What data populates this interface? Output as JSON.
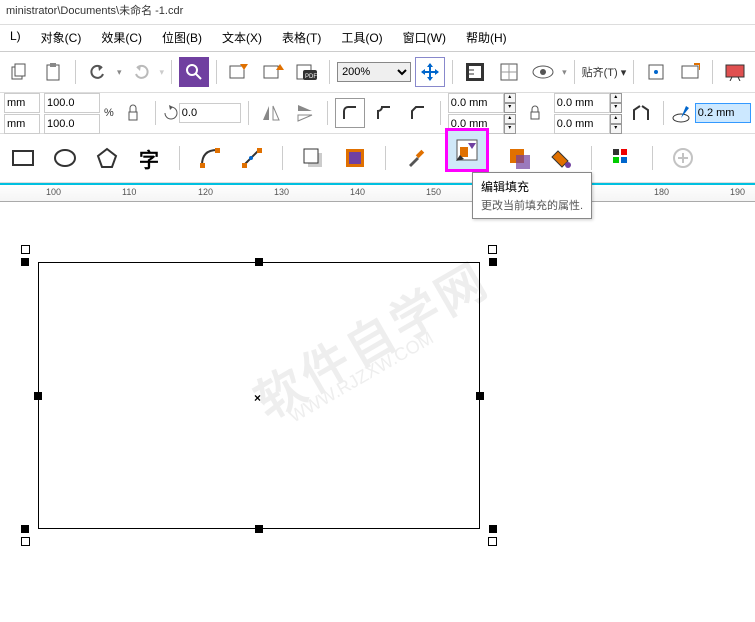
{
  "title": "ministrator\\Documents\\未命名 -1.cdr",
  "menu": {
    "layout": "L)",
    "object": "对象(C)",
    "effects": "效果(C)",
    "bitmap": "位图(B)",
    "text": "文本(X)",
    "table": "表格(T)",
    "tools": "工具(O)",
    "window": "窗口(W)",
    "help": "帮助(H)"
  },
  "toolbar": {
    "zoom": "200%",
    "snap": "贴齐(T) ▾"
  },
  "prop": {
    "x": "mm",
    "y": "mm",
    "w": "100.0",
    "h": "100.0",
    "pct": "%",
    "rot": "0.0",
    "ox1": "0.0 mm",
    "oy1": "0.0 mm",
    "ox2": "0.0 mm",
    "oy2": "0.0 mm",
    "outline": "0.2 mm"
  },
  "ruler": {
    "t100": "100",
    "t110": "110",
    "t120": "120",
    "t130": "130",
    "t140": "140",
    "t150": "150",
    "t180": "180",
    "t190": "190"
  },
  "tooltip": {
    "title": "编辑填充",
    "desc": "更改当前填充的属性."
  },
  "watermark": {
    "main": "软件自学网",
    "sub": "WWW.RJZXW.COM"
  },
  "text_char": "字"
}
